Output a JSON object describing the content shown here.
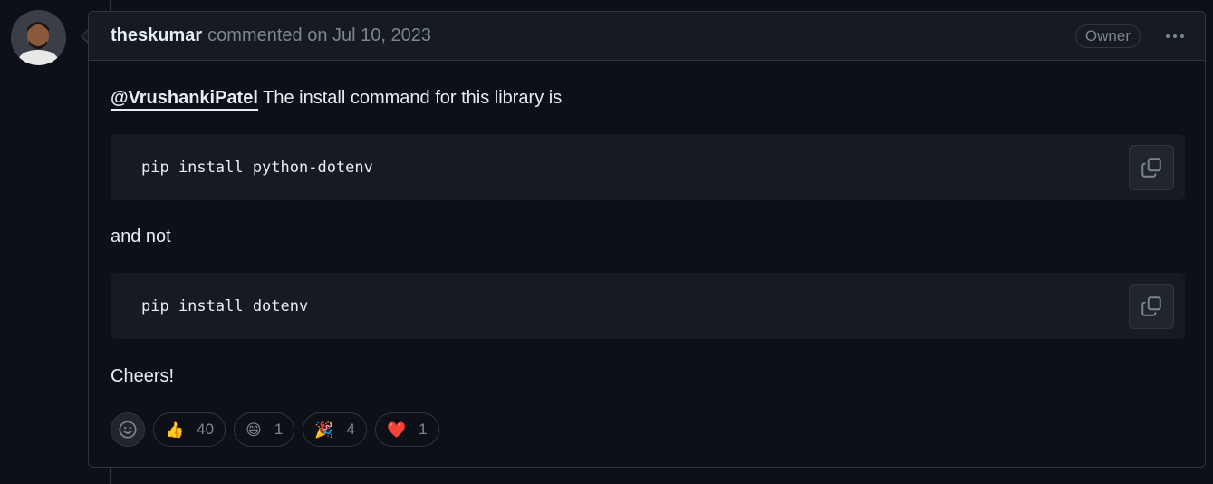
{
  "comment": {
    "author": "theskumar",
    "meta": "commented on Jul 10, 2023",
    "badge": "Owner",
    "mention": "@VrushankiPatel",
    "intro": "The install command for this library is",
    "code1": "pip install python-dotenv",
    "middle": "and not",
    "code2": "pip install dotenv",
    "closing": "Cheers!"
  },
  "reactions": [
    {
      "icon": "thumbs-up-icon",
      "emoji": "👍",
      "count": "40"
    },
    {
      "icon": "laugh-icon",
      "emoji": "😄",
      "count": "1"
    },
    {
      "icon": "party-popper-icon",
      "emoji": "🎉",
      "count": "4"
    },
    {
      "icon": "heart-icon",
      "emoji": "❤️",
      "count": "1"
    }
  ],
  "colors": {
    "background": "#0d1117",
    "header": "#161b22",
    "border": "#30363d",
    "muted": "#7d8590"
  }
}
